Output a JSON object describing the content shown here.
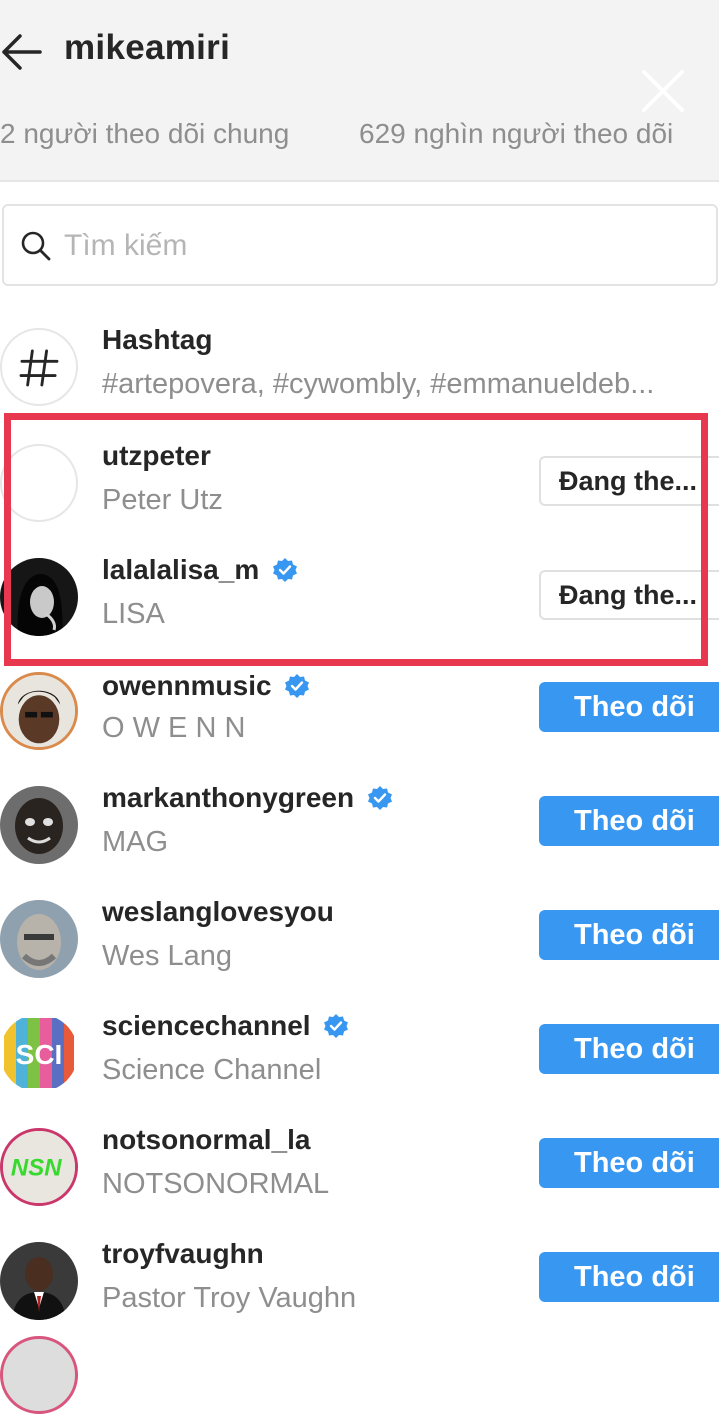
{
  "header": {
    "title": "mikeamiri",
    "tab_mutual": "2 người theo dõi chung",
    "tab_followers": "629 nghìn người theo dõi"
  },
  "search": {
    "placeholder": "Tìm kiếm"
  },
  "hashtag": {
    "title": "Hashtag",
    "subtitle": "#artepovera, #cywombly, #emmanueldeb..."
  },
  "following_rows": [
    {
      "username": "utzpeter",
      "fullname": "Peter Utz",
      "verified": false,
      "button": "Đang the..."
    },
    {
      "username": "lalalalisa_m",
      "fullname": "LISA",
      "verified": true,
      "button": "Đang the..."
    }
  ],
  "suggested_rows": [
    {
      "username": "owennmusic",
      "fullname": "O W E N N",
      "verified": true,
      "button": "Theo dõi"
    },
    {
      "username": "markanthonygreen",
      "fullname": "MAG",
      "verified": true,
      "button": "Theo dõi"
    },
    {
      "username": "weslanglovesyou",
      "fullname": "Wes Lang",
      "verified": false,
      "button": "Theo dõi"
    },
    {
      "username": "sciencechannel",
      "fullname": "Science Channel",
      "verified": true,
      "button": "Theo dõi"
    },
    {
      "username": "notsonormal_la",
      "fullname": "NOTSONORMAL",
      "verified": false,
      "button": "Theo dõi"
    },
    {
      "username": "troyfvaughn",
      "fullname": "Pastor Troy Vaughn",
      "verified": false,
      "button": "Theo dõi"
    }
  ],
  "avatar_logos": {
    "sciencechannel": "SCI",
    "notsonormal_la": "NSN"
  },
  "colors": {
    "follow_button": "#3897f0",
    "verified_badge": "#3897f0",
    "highlight_box": "#e8384f",
    "secondary_text": "#8e8e8e"
  },
  "icons": [
    "back-arrow-icon",
    "close-icon",
    "search-icon",
    "hashtag-icon",
    "verified-badge-icon"
  ]
}
